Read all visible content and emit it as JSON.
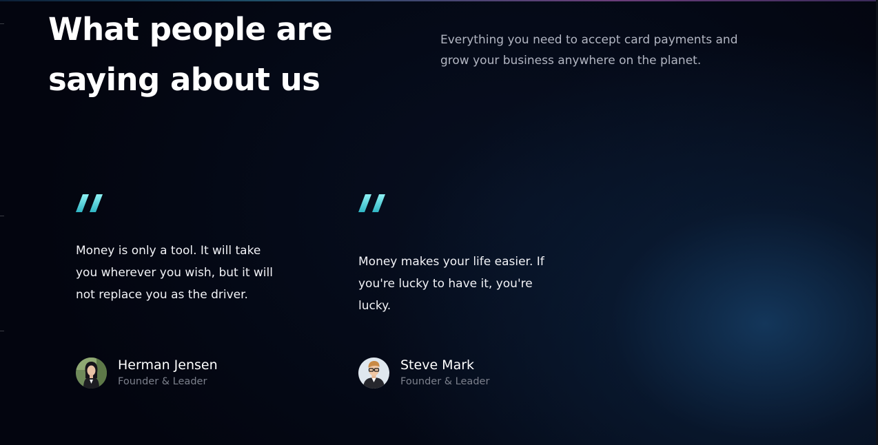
{
  "section": {
    "heading": "What people are saying about us",
    "intro": "Everything you need to accept card payments and grow your business anywhere on the planet."
  },
  "testimonials": [
    {
      "quote": "Money is only a tool. It will take you wherever you wish, but it will not replace you as the driver.",
      "name": "Herman Jensen",
      "role": "Founder & Leader",
      "avatar_icon": "avatar-woman-photo"
    },
    {
      "quote": "Money makes your life easier. If you're lucky to have it, you're lucky.",
      "name": "Steve Mark",
      "role": "Founder & Leader",
      "avatar_icon": "avatar-man-photo"
    }
  ],
  "colors": {
    "background": "#03050f",
    "quote_accent": "#5fe0e6",
    "muted_text": "#b2b6c2",
    "role_text": "#7c808c"
  }
}
